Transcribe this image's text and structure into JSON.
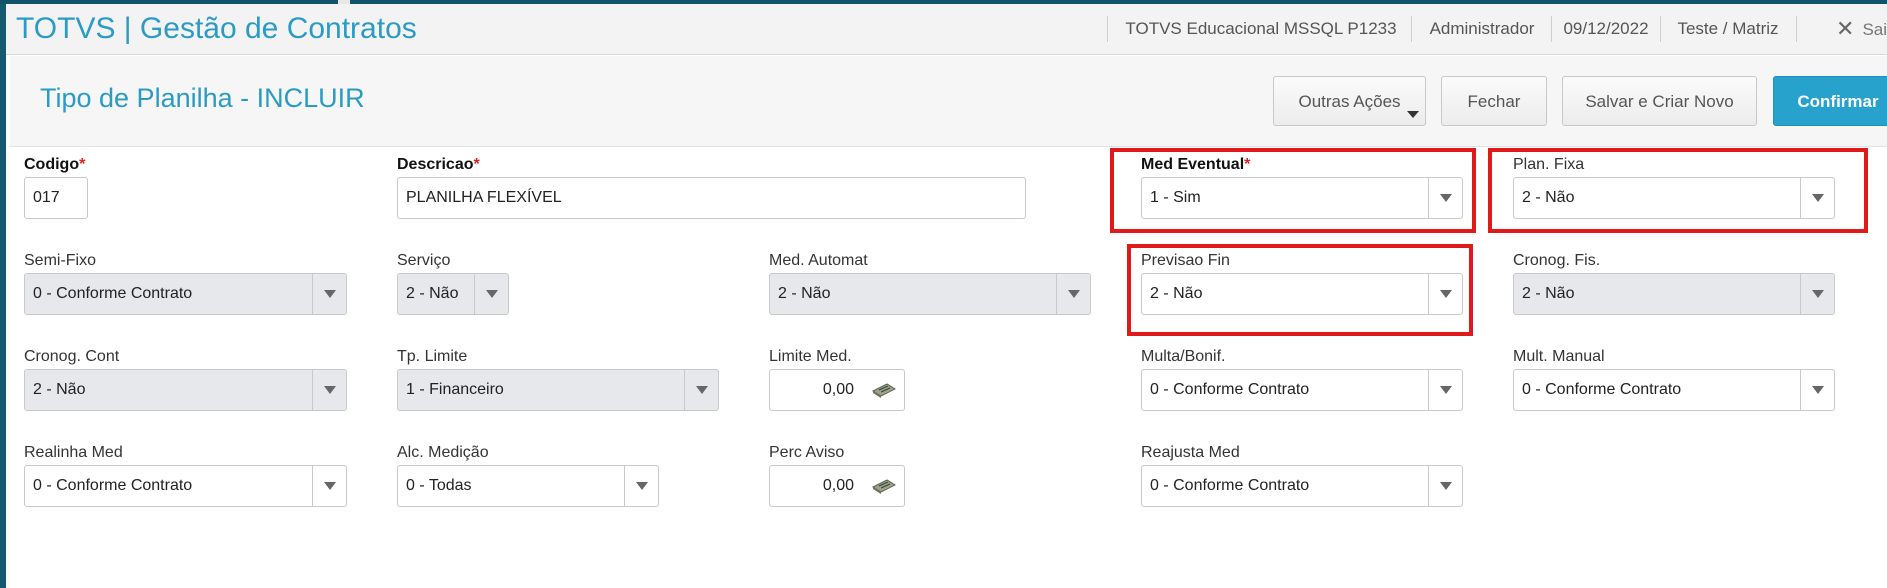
{
  "app": {
    "title": "TOTVS | Gestão de Contratos",
    "environment": "TOTVS Educacional MSSQL P1233",
    "user": "Administrador",
    "date": "09/12/2022",
    "company": "Teste / Matriz",
    "exit_label": "Sai"
  },
  "page": {
    "title": "Tipo de Planilha - INCLUIR"
  },
  "actions": {
    "more_label": "Outras Ações",
    "close_label": "Fechar",
    "save_new_label": "Salvar e Criar Novo",
    "confirm_label": "Confirmar"
  },
  "fields": {
    "codigo": {
      "label": "Codigo",
      "required": "*",
      "value": "017"
    },
    "descricao": {
      "label": "Descricao",
      "required": "*",
      "value": "PLANILHA FLEXÍVEL"
    },
    "med_eventual": {
      "label": "Med Eventual",
      "required": "*",
      "value": "1 - Sim"
    },
    "plan_fixa": {
      "label": "Plan. Fixa",
      "value": "2 - Não"
    },
    "semi_fixo": {
      "label": "Semi-Fixo",
      "value": "0 - Conforme Contrato"
    },
    "servico": {
      "label": "Serviço",
      "value": "2 - Não"
    },
    "med_automat": {
      "label": "Med. Automat",
      "value": "2 - Não"
    },
    "previsao_fin": {
      "label": "Previsao Fin",
      "value": "2 - Não"
    },
    "cronog_fis": {
      "label": "Cronog. Fis.",
      "value": "2 - Não"
    },
    "cronog_cont": {
      "label": "Cronog. Cont",
      "value": "2 - Não"
    },
    "tp_limite": {
      "label": "Tp. Limite",
      "value": "1 - Financeiro"
    },
    "limite_med": {
      "label": "Limite Med.",
      "value": "0,00"
    },
    "multa_bonif": {
      "label": "Multa/Bonif.",
      "value": "0 - Conforme Contrato"
    },
    "mult_manual": {
      "label": "Mult. Manual",
      "value": "0 - Conforme Contrato"
    },
    "realinha_med": {
      "label": "Realinha Med",
      "value": "0 - Conforme Contrato"
    },
    "alc_medicao": {
      "label": "Alc. Medição",
      "value": "0 - Todas"
    },
    "perc_aviso": {
      "label": "Perc Aviso",
      "value": "0,00"
    },
    "reajusta_med": {
      "label": "Reajusta Med",
      "value": "0 - Conforme Contrato"
    }
  },
  "colors": {
    "accent": "#2a9bc4",
    "primary_button": "#26a2cc",
    "highlight": "#e01a1a",
    "required": "#e02020"
  }
}
